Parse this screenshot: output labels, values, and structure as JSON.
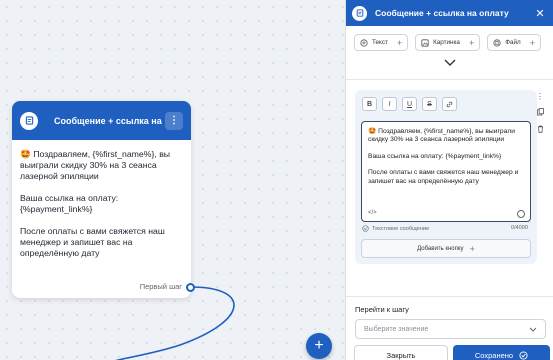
{
  "node": {
    "title": "Сообщение + ссылка на",
    "menu_glyph": "⋮",
    "paragraphs": [
      "🤩 Поздравляем, {%first_name%}, вы выиграли скидку 30% на 3 сеанса лазерной эпиляции",
      "Ваша ссылка на оплату: {%payment_link%}",
      "После оплаты с вами свяжется наш менеджер и запишет вас на определённую дату"
    ],
    "step_label": "Первый шаг"
  },
  "canvas": {
    "add_glyph": "+"
  },
  "panel": {
    "title": "Сообщение + ссылка на оплату",
    "close_glyph": "✕",
    "chips": [
      {
        "label": "Текст",
        "icon": "text-icon"
      },
      {
        "label": "Картинка",
        "icon": "image-icon"
      },
      {
        "label": "Файл",
        "icon": "file-icon"
      }
    ],
    "format_buttons": [
      "B",
      "I",
      "U",
      "S",
      "🔗"
    ],
    "editor_lines": [
      "🤩 Поздравляем, {%first_name%}, вы выиграли скидку 30% на 3 сеанса лазерной эпиляции",
      "Ваша ссылка на оплату: {%payment_link%}",
      "После оплаты с вами свяжется наш менеджер и запишет вас на определённую дату"
    ],
    "code_glyph": "</>",
    "message_type": "Текстовое сообщение",
    "char_count": "0/4000",
    "add_button": "Добавить кнопку",
    "goto_label": "Перейти к шагу",
    "select_placeholder": "Выберите значение",
    "close_button": "Закрыть",
    "save_button": "Сохранено"
  },
  "colors": {
    "accent": "#1f5fbf",
    "canvas": "#eef1f5",
    "editor_bg": "#eef3fa"
  }
}
